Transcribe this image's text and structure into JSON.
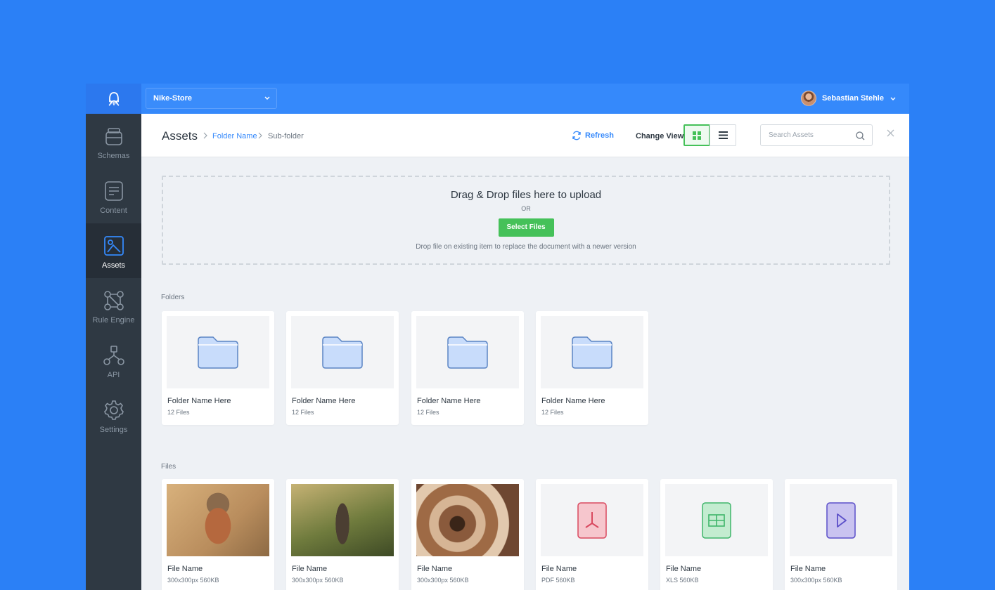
{
  "topbar": {
    "app_selector": "Nike-Store",
    "user_name": "Sebastian Stehle"
  },
  "sidebar": {
    "items": [
      {
        "label": "Schemas",
        "icon": "schemas-icon"
      },
      {
        "label": "Content",
        "icon": "content-icon"
      },
      {
        "label": "Assets",
        "icon": "assets-icon",
        "active": true
      },
      {
        "label": "Rule Engine",
        "icon": "rule-engine-icon"
      },
      {
        "label": "API",
        "icon": "api-icon"
      },
      {
        "label": "Settings",
        "icon": "gear-icon"
      }
    ]
  },
  "header": {
    "title": "Assets",
    "breadcrumbs": [
      "Folder Name",
      "Sub-folder"
    ],
    "refresh_label": "Refresh",
    "change_view_label": "Change View",
    "search_placeholder": "Search Assets"
  },
  "dropzone": {
    "title": "Drag & Drop files here to upload",
    "or_label": "OR",
    "button_label": "Select Files",
    "note": "Drop file on existing item to replace the document with a newer version"
  },
  "folders": {
    "label": "Folders",
    "items": [
      {
        "name": "Folder Name Here",
        "count": "12 Files"
      },
      {
        "name": "Folder Name Here",
        "count": "12 Files"
      },
      {
        "name": "Folder Name Here",
        "count": "12 Files"
      },
      {
        "name": "Folder Name Here",
        "count": "12 Files"
      }
    ]
  },
  "files": {
    "label": "Files",
    "items": [
      {
        "name": "File Name",
        "meta": "300x300px 560KB",
        "preview": "owl-photo"
      },
      {
        "name": "File Name",
        "meta": "300x300px 560KB",
        "preview": "bird-photo"
      },
      {
        "name": "File Name",
        "meta": "300x300px 560KB",
        "preview": "staircase-photo"
      },
      {
        "name": "File Name",
        "meta": "PDF 560KB",
        "preview": "pdf-icon"
      },
      {
        "name": "File Name",
        "meta": "XLS 560KB",
        "preview": "xls-icon"
      },
      {
        "name": "File Name",
        "meta": "300x300px 560KB",
        "preview": "video-icon"
      }
    ]
  },
  "colors": {
    "background": "#2b80f6",
    "topbar": "#3589fb",
    "sidebar": "#2f3943",
    "accent_green": "#45c159",
    "link_blue": "#3589fb"
  }
}
